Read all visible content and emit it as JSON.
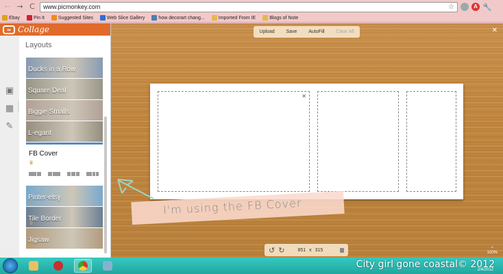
{
  "browser": {
    "back": "←",
    "forward": "→",
    "reload": "C",
    "url": "www.picmonkey.com",
    "star": "☆",
    "ext_red": "A",
    "wrench": "🔧"
  },
  "bookmarks": [
    {
      "label": "Ebay",
      "color": "#e0a020"
    },
    {
      "label": "Pin It",
      "color": "#cc2233"
    },
    {
      "label": "Suggested Sites",
      "color": "#f08a1c"
    },
    {
      "label": "Web Slice Gallery",
      "color": "#2a6fd6"
    },
    {
      "label": "how decorart chang...",
      "color": "#4a7fb0"
    },
    {
      "label": "Imported From IE",
      "color": "#e8b84a"
    },
    {
      "label": "Blogs of Note",
      "color": "#e8b84a"
    }
  ],
  "app": {
    "title": "Collage",
    "panel_title": "Layouts"
  },
  "layouts": [
    {
      "label": "Ducks in a Row",
      "bg": "#7a8fa8"
    },
    {
      "label": "Square Deal",
      "bg": "#8c8a7a"
    },
    {
      "label": "Biggie Smalls",
      "bg": "#a8968a"
    },
    {
      "label": "L-egant",
      "bg": "#8a8270"
    },
    {
      "label": "FB Cover",
      "selected": true,
      "crown": "♛"
    },
    {
      "label": "Pinter-etsy",
      "bg": "#6a9fc8",
      "crown": "♛"
    },
    {
      "label": "Tile Border",
      "bg": "#5a7088",
      "crown": "♛"
    },
    {
      "label": "Jigsaw",
      "bg": "#a89070",
      "crown": "♛"
    }
  ],
  "toolbar": {
    "upload": "Upload",
    "save": "Save",
    "autofill": "AutoFill",
    "clear_all": "Clear All"
  },
  "caption": "I'm using the FB Cover",
  "dimensions": {
    "width": "851",
    "x": "x",
    "height": "315"
  },
  "zoom": "100%",
  "watermark": "City girl gone coastal© 2012",
  "clock": "2/4/2012"
}
